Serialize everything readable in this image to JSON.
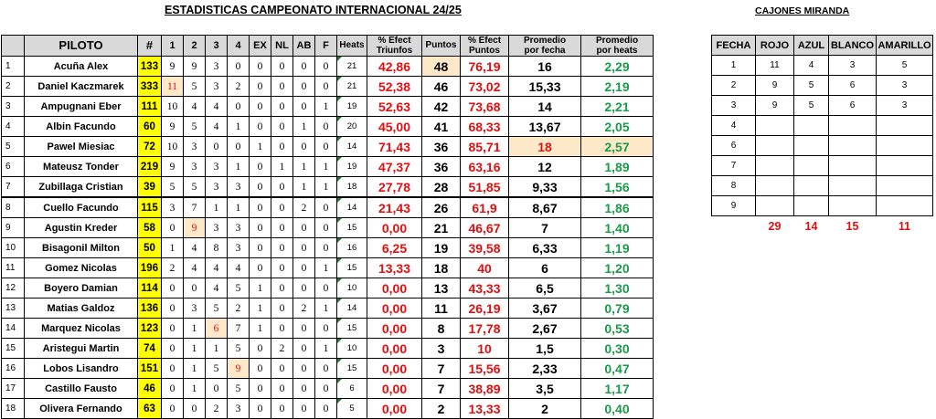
{
  "title": "ESTADISTICAS CAMPEONATO INTERNACIONAL 24/25",
  "subtitle": "CAJONES MIRANDA",
  "headers": {
    "piloto": "PILOTO",
    "num": "#",
    "c1": "1",
    "c2": "2",
    "c3": "3",
    "c4": "4",
    "ex": "EX",
    "nl": "NL",
    "ab": "AB",
    "f": "F",
    "heats": "Heats",
    "efect_tri_1": "% Efect",
    "efect_tri_2": "Triunfos",
    "puntos": "Puntos",
    "efect_pts_1": "% Efect",
    "efect_pts_2": "Puntos",
    "prom_fecha_1": "Promedio",
    "prom_fecha_2": "por fecha",
    "prom_heats_1": "Promedio",
    "prom_heats_2": "por heats"
  },
  "rows": [
    {
      "idx": "1",
      "name": "Acuña Alex",
      "num": "133",
      "c1": "9",
      "c2": "9",
      "c3": "3",
      "c4": "0",
      "ex": "0",
      "nl": "0",
      "ab": "0",
      "f": "0",
      "heats": "21",
      "efect_tri": "42,86",
      "puntos": "48",
      "efect_pts": "76,19",
      "prom_fecha": "16",
      "prom_heats": "2,29"
    },
    {
      "idx": "2",
      "name": "Daniel Kaczmarek",
      "num": "333",
      "c1": "11",
      "c2": "5",
      "c3": "3",
      "c4": "2",
      "ex": "0",
      "nl": "0",
      "ab": "0",
      "f": "0",
      "heats": "21",
      "efect_tri": "52,38",
      "puntos": "46",
      "efect_pts": "73,02",
      "prom_fecha": "15,33",
      "prom_heats": "2,19"
    },
    {
      "idx": "3",
      "name": "Ampugnani Eber",
      "num": "111",
      "c1": "10",
      "c2": "4",
      "c3": "4",
      "c4": "0",
      "ex": "0",
      "nl": "0",
      "ab": "0",
      "f": "1",
      "heats": "19",
      "efect_tri": "52,63",
      "puntos": "42",
      "efect_pts": "73,68",
      "prom_fecha": "14",
      "prom_heats": "2,21"
    },
    {
      "idx": "4",
      "name": "Albin Facundo",
      "num": "60",
      "c1": "9",
      "c2": "5",
      "c3": "4",
      "c4": "1",
      "ex": "0",
      "nl": "0",
      "ab": "1",
      "f": "0",
      "heats": "20",
      "efect_tri": "45,00",
      "puntos": "41",
      "efect_pts": "68,33",
      "prom_fecha": "13,67",
      "prom_heats": "2,05"
    },
    {
      "idx": "5",
      "name": "Pawel Miesiac",
      "num": "72",
      "c1": "10",
      "c2": "3",
      "c3": "0",
      "c4": "0",
      "ex": "1",
      "nl": "0",
      "ab": "0",
      "f": "0",
      "heats": "14",
      "efect_tri": "71,43",
      "puntos": "36",
      "efect_pts": "85,71",
      "prom_fecha": "18",
      "prom_heats": "2,57"
    },
    {
      "idx": "6",
      "name": "Mateusz  Tonder",
      "num": "219",
      "c1": "9",
      "c2": "3",
      "c3": "3",
      "c4": "1",
      "ex": "0",
      "nl": "1",
      "ab": "1",
      "f": "1",
      "heats": "19",
      "efect_tri": "47,37",
      "puntos": "36",
      "efect_pts": "63,16",
      "prom_fecha": "12",
      "prom_heats": "1,89"
    },
    {
      "idx": "7",
      "name": "Zubillaga Cristian",
      "num": "39",
      "c1": "5",
      "c2": "5",
      "c3": "3",
      "c4": "3",
      "ex": "0",
      "nl": "0",
      "ab": "1",
      "f": "1",
      "heats": "18",
      "efect_tri": "27,78",
      "puntos": "28",
      "efect_pts": "51,85",
      "prom_fecha": "9,33",
      "prom_heats": "1,56"
    },
    {
      "idx": "8",
      "name": "Cuello Facundo",
      "num": "115",
      "c1": "3",
      "c2": "7",
      "c3": "1",
      "c4": "1",
      "ex": "0",
      "nl": "0",
      "ab": "2",
      "f": "0",
      "heats": "14",
      "efect_tri": "21,43",
      "puntos": "26",
      "efect_pts": "61,9",
      "prom_fecha": "8,67",
      "prom_heats": "1,86"
    },
    {
      "idx": "9",
      "name": "Agustin Kreder",
      "num": "58",
      "c1": "0",
      "c2": "9",
      "c3": "3",
      "c4": "3",
      "ex": "0",
      "nl": "0",
      "ab": "0",
      "f": "0",
      "heats": "15",
      "efect_tri": "0,00",
      "puntos": "21",
      "efect_pts": "46,67",
      "prom_fecha": "7",
      "prom_heats": "1,40"
    },
    {
      "idx": "10",
      "name": "Bisagonil Milton",
      "num": "50",
      "c1": "1",
      "c2": "4",
      "c3": "8",
      "c4": "3",
      "ex": "0",
      "nl": "0",
      "ab": "0",
      "f": "0",
      "heats": "16",
      "efect_tri": "6,25",
      "puntos": "19",
      "efect_pts": "39,58",
      "prom_fecha": "6,33",
      "prom_heats": "1,19"
    },
    {
      "idx": "11",
      "name": "Gomez Nicolas",
      "num": "196",
      "c1": "2",
      "c2": "4",
      "c3": "4",
      "c4": "4",
      "ex": "0",
      "nl": "0",
      "ab": "0",
      "f": "1",
      "heats": "15",
      "efect_tri": "13,33",
      "puntos": "18",
      "efect_pts": "40",
      "prom_fecha": "6",
      "prom_heats": "1,20"
    },
    {
      "idx": "12",
      "name": "Boyero Damian",
      "num": "114",
      "c1": "0",
      "c2": "0",
      "c3": "4",
      "c4": "5",
      "ex": "1",
      "nl": "0",
      "ab": "0",
      "f": "0",
      "heats": "10",
      "efect_tri": "0,00",
      "puntos": "13",
      "efect_pts": "43,33",
      "prom_fecha": "6,5",
      "prom_heats": "1,30"
    },
    {
      "idx": "13",
      "name": "Matias Galdoz",
      "num": "136",
      "c1": "0",
      "c2": "3",
      "c3": "5",
      "c4": "2",
      "ex": "1",
      "nl": "0",
      "ab": "2",
      "f": "1",
      "heats": "14",
      "efect_tri": "0,00",
      "puntos": "11",
      "efect_pts": "26,19",
      "prom_fecha": "3,67",
      "prom_heats": "0,79"
    },
    {
      "idx": "14",
      "name": "Marquez Nicolas",
      "num": "123",
      "c1": "0",
      "c2": "1",
      "c3": "6",
      "c4": "7",
      "ex": "1",
      "nl": "0",
      "ab": "0",
      "f": "0",
      "heats": "15",
      "efect_tri": "0,00",
      "puntos": "8",
      "efect_pts": "17,78",
      "prom_fecha": "2,67",
      "prom_heats": "0,53"
    },
    {
      "idx": "15",
      "name": "Aristegui Martin",
      "num": "74",
      "c1": "0",
      "c2": "1",
      "c3": "1",
      "c4": "5",
      "ex": "0",
      "nl": "2",
      "ab": "0",
      "f": "1",
      "heats": "10",
      "efect_tri": "0,00",
      "puntos": "3",
      "efect_pts": "10",
      "prom_fecha": "1,5",
      "prom_heats": "0,30"
    },
    {
      "idx": "16",
      "name": "Lobos Lisandro",
      "num": "151",
      "c1": "0",
      "c2": "1",
      "c3": "5",
      "c4": "9",
      "ex": "0",
      "nl": "0",
      "ab": "0",
      "f": "0",
      "heats": "15",
      "efect_tri": "0,00",
      "puntos": "7",
      "efect_pts": "15,56",
      "prom_fecha": "2,33",
      "prom_heats": "0,47"
    },
    {
      "idx": "17",
      "name": "Castillo Fausto",
      "num": "46",
      "c1": "0",
      "c2": "1",
      "c3": "0",
      "c4": "5",
      "ex": "0",
      "nl": "0",
      "ab": "0",
      "f": "0",
      "heats": "6",
      "efect_tri": "0,00",
      "puntos": "7",
      "efect_pts": "38,89",
      "prom_fecha": "3,5",
      "prom_heats": "1,17"
    },
    {
      "idx": "18",
      "name": "Olivera Fernando",
      "num": "63",
      "c1": "0",
      "c2": "0",
      "c3": "2",
      "c4": "3",
      "ex": "0",
      "nl": "0",
      "ab": "0",
      "f": "0",
      "heats": "5",
      "efect_tri": "0,00",
      "puntos": "2",
      "efect_pts": "13,33",
      "prom_fecha": "2",
      "prom_heats": "0,40"
    }
  ],
  "cajones": {
    "headers": {
      "fecha": "FECHA",
      "rojo": "ROJO",
      "azul": "AZUL",
      "blanco": "BLANCO",
      "amarillo": "AMARILLO"
    },
    "rows": [
      {
        "fecha": "1",
        "rojo": "11",
        "azul": "4",
        "blanco": "3",
        "amarillo": "5"
      },
      {
        "fecha": "2",
        "rojo": "9",
        "azul": "5",
        "blanco": "6",
        "amarillo": "3"
      },
      {
        "fecha": "3",
        "rojo": "9",
        "azul": "5",
        "blanco": "6",
        "amarillo": "3"
      },
      {
        "fecha": "4",
        "rojo": "",
        "azul": "",
        "blanco": "",
        "amarillo": ""
      },
      {
        "fecha": "6",
        "rojo": "",
        "azul": "",
        "blanco": "",
        "amarillo": ""
      },
      {
        "fecha": "7",
        "rojo": "",
        "azul": "",
        "blanco": "",
        "amarillo": ""
      },
      {
        "fecha": "8",
        "rojo": "",
        "azul": "",
        "blanco": "",
        "amarillo": ""
      },
      {
        "fecha": "9",
        "rojo": "",
        "azul": "",
        "blanco": "",
        "amarillo": ""
      }
    ],
    "totals": {
      "rojo": "29",
      "azul": "14",
      "blanco": "15",
      "amarillo": "11"
    }
  },
  "colors": {
    "highlight_number": "#ffff00",
    "header_bg": "#d9d9d9",
    "red": "#e01010",
    "green": "#1a9a4a",
    "highlight_cell": "#fde9c8"
  }
}
